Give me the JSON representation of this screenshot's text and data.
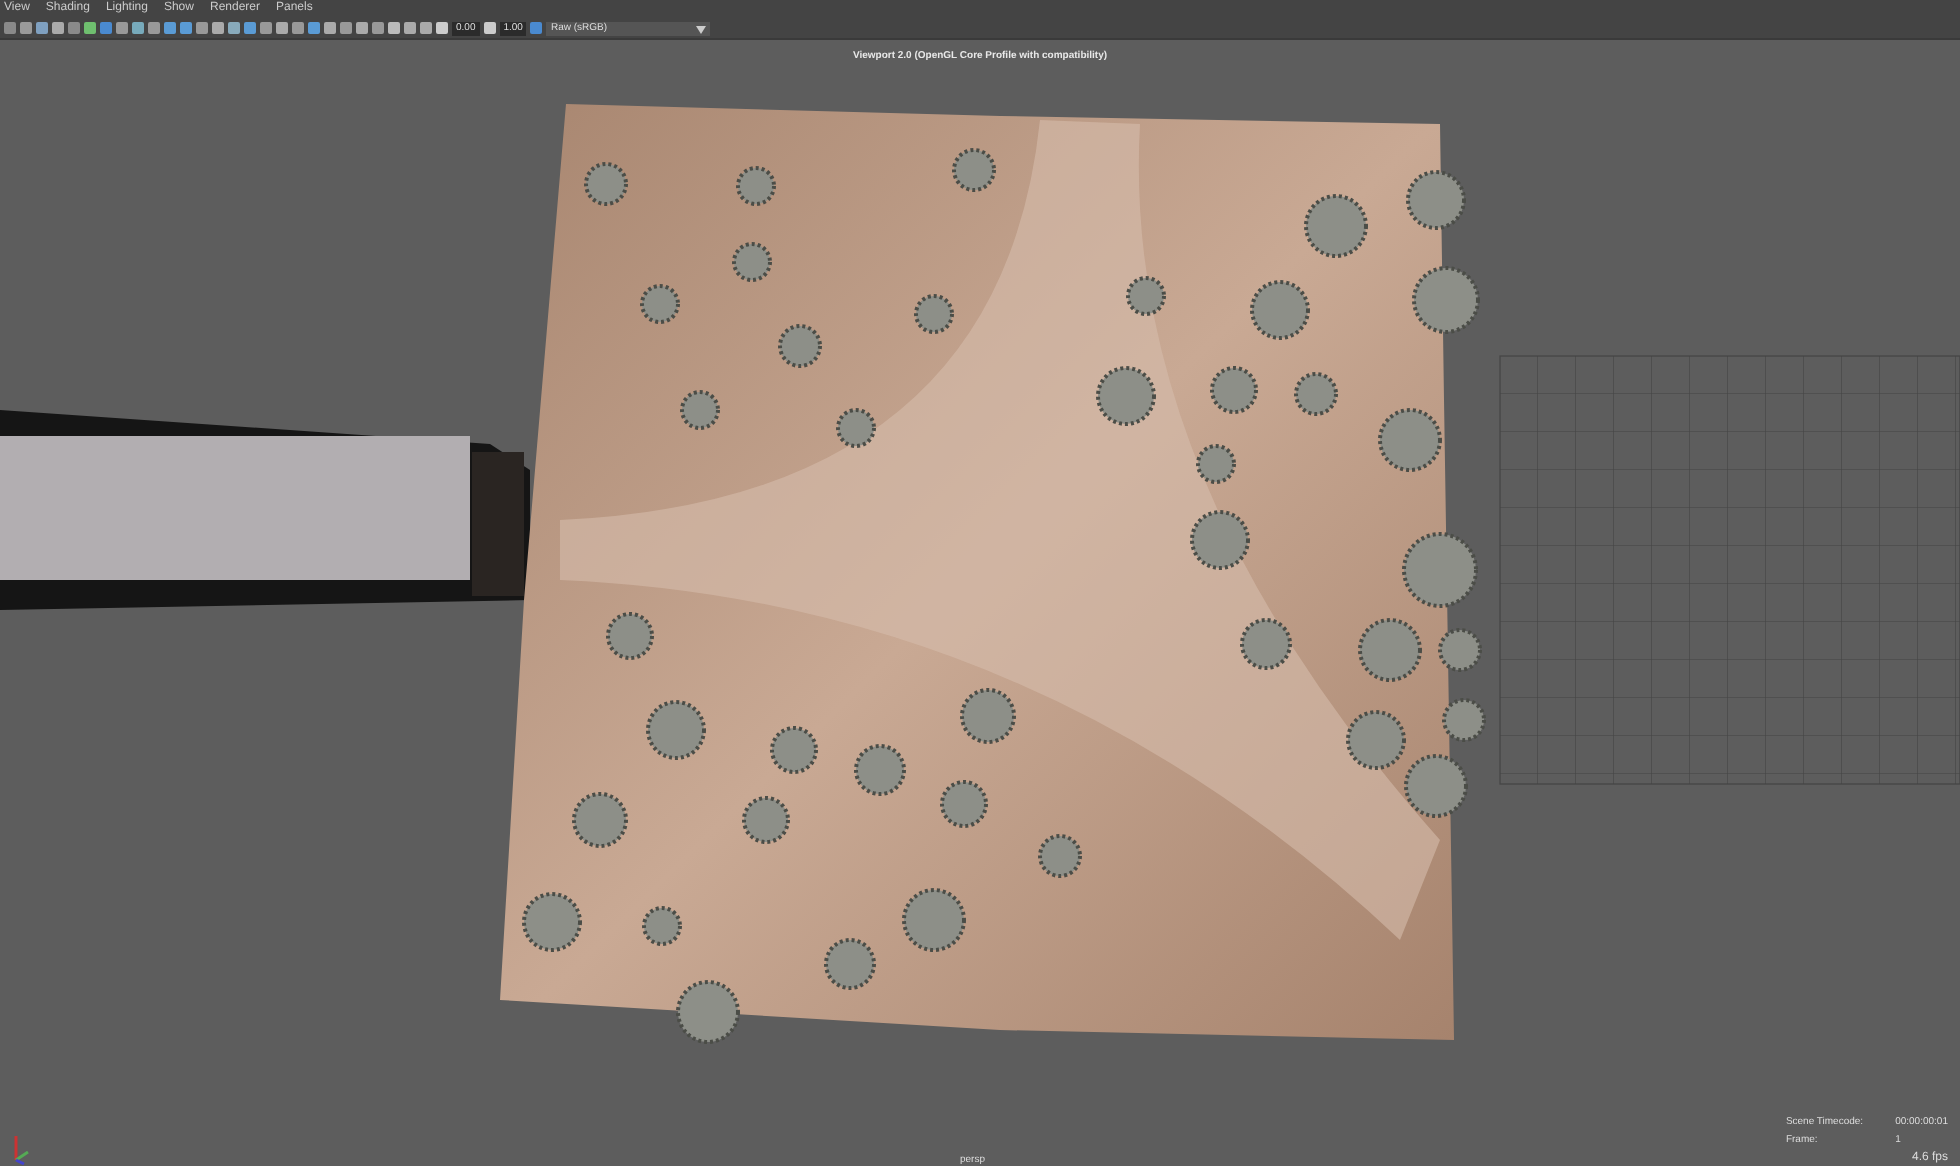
{
  "menu": [
    "View",
    "Shading",
    "Lighting",
    "Show",
    "Renderer",
    "Panels"
  ],
  "toolbar": {
    "exposure": "0.00",
    "gamma": "1.00",
    "color_space": "Raw (sRGB)"
  },
  "viewport": {
    "renderer_title": "Viewport 2.0 (OpenGL Core Profile with compatibility)",
    "camera": "persp",
    "hud": [
      {
        "label": "Scene Timecode:",
        "value": "00:00:00:01"
      },
      {
        "label": "Frame:",
        "value": "1"
      }
    ],
    "fps": "4.6 fps"
  }
}
